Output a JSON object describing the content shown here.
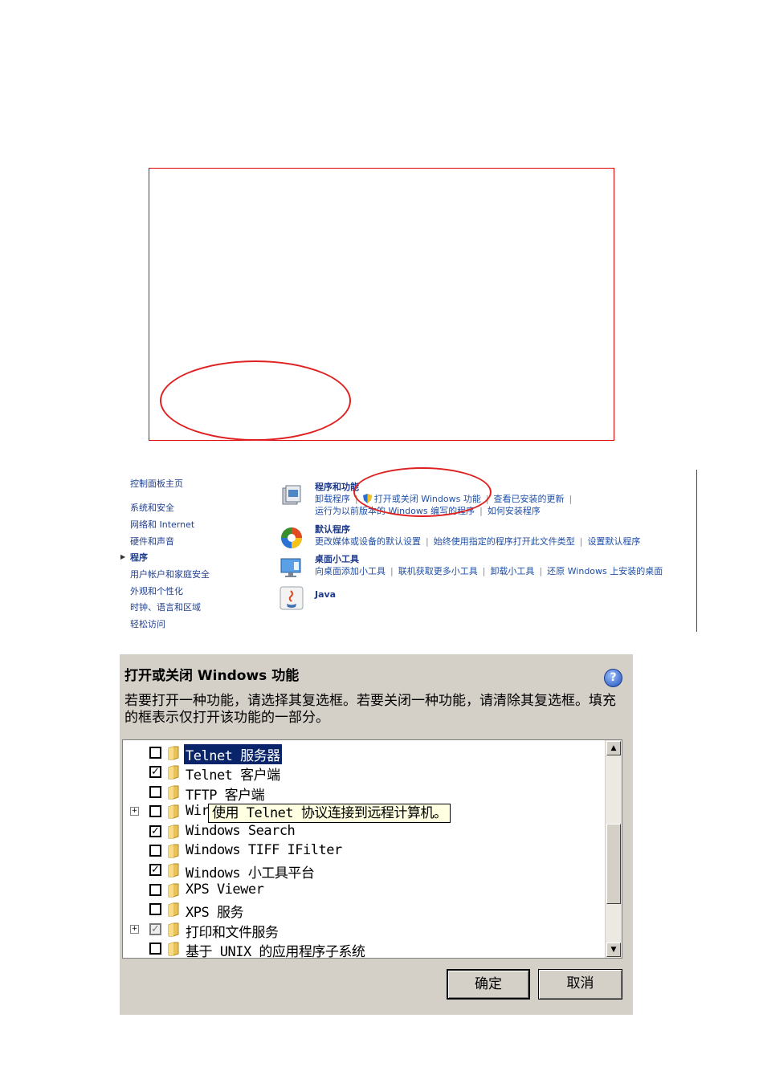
{
  "control_panel": {
    "nav": [
      {
        "label": "控制面板主页",
        "active": false
      },
      {
        "label": "系统和安全",
        "active": false
      },
      {
        "label": "网络和 Internet",
        "active": false
      },
      {
        "label": "硬件和声音",
        "active": false
      },
      {
        "label": "程序",
        "active": true
      },
      {
        "label": "用户帐户和家庭安全",
        "active": false
      },
      {
        "label": "外观和个性化",
        "active": false
      },
      {
        "label": "时钟、语言和区域",
        "active": false
      },
      {
        "label": "轻松访问",
        "active": false
      }
    ],
    "categories": [
      {
        "title": "程序和功能",
        "icon": "programs-features-icon",
        "links_row1": [
          "卸载程序",
          "打开或关闭 Windows 功能",
          "查看已安装的更新"
        ],
        "links_row2": [
          "运行为以前版本的 Windows 编写的程序",
          "如何安装程序"
        ]
      },
      {
        "title": "默认程序",
        "icon": "default-programs-icon",
        "links_row1": [
          "更改媒体或设备的默认设置",
          "始终使用指定的程序打开此文件类型",
          "设置默认程序"
        ]
      },
      {
        "title": "桌面小工具",
        "icon": "desktop-gadgets-icon",
        "links_row1": [
          "向桌面添加小工具",
          "联机获取更多小工具",
          "卸载小工具",
          "还原 Windows 上安装的桌面"
        ]
      },
      {
        "title": "Java",
        "icon": "java-icon"
      }
    ]
  },
  "dialog": {
    "title": "打开或关闭 Windows 功能",
    "description": "若要打开一种功能，请选择其复选框。若要关闭一种功能，请清除其复选框。填充的框表示仅打开该功能的一部分。",
    "features": [
      {
        "label": "Telnet 服务器",
        "state": "unchecked",
        "expandable": false,
        "selected": true
      },
      {
        "label": "Telnet 客户端",
        "state": "checked",
        "expandable": false,
        "selected": false
      },
      {
        "label": "TFTP 客户端",
        "state": "unchecked",
        "expandable": false,
        "selected": false
      },
      {
        "label": "Wir",
        "state": "unchecked",
        "expandable": true,
        "selected": false
      },
      {
        "label": "Windows Search",
        "state": "checked",
        "expandable": false,
        "selected": false
      },
      {
        "label": "Windows TIFF IFilter",
        "state": "unchecked",
        "expandable": false,
        "selected": false
      },
      {
        "label": "Windows 小工具平台",
        "state": "checked",
        "expandable": false,
        "selected": false
      },
      {
        "label": "XPS Viewer",
        "state": "unchecked",
        "expandable": false,
        "selected": false
      },
      {
        "label": "XPS 服务",
        "state": "unchecked",
        "expandable": false,
        "selected": false
      },
      {
        "label": "打印和文件服务",
        "state": "partial",
        "expandable": true,
        "selected": false
      },
      {
        "label": "基于 UNIX 的应用程序子系统",
        "state": "unchecked",
        "expandable": false,
        "selected": false
      }
    ],
    "tooltip": "使用 Telnet 协议连接到远程计算机。",
    "ok_label": "确定",
    "cancel_label": "取消",
    "check_mark": "✓",
    "partial_mark": "✓",
    "expander_symbol": "+"
  },
  "annotations_color": "#e02020"
}
